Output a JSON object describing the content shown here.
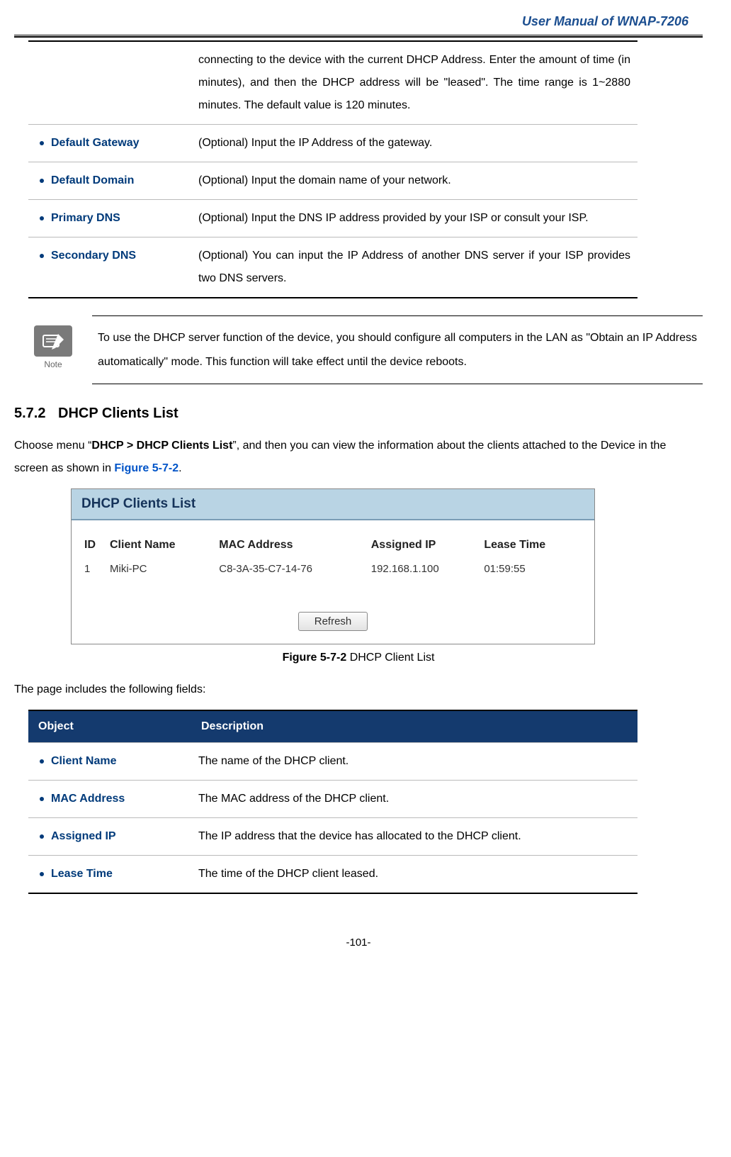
{
  "header": {
    "title": "User Manual of WNAP-7206"
  },
  "table1": {
    "rows": [
      {
        "term": "",
        "desc": "connecting to the device with the current DHCP Address. Enter the amount of time (in minutes), and then the DHCP address will be \"leased\". The time range is 1~2880 minutes. The default value is 120 minutes."
      },
      {
        "term": "Default Gateway",
        "desc": "(Optional) Input the IP Address of the gateway."
      },
      {
        "term": "Default Domain",
        "desc": "(Optional) Input the domain name of your network."
      },
      {
        "term": "Primary DNS",
        "desc": "(Optional) Input the DNS IP address provided by your ISP or consult your ISP."
      },
      {
        "term": "Secondary DNS",
        "desc": "(Optional) You can input the IP Address of another DNS server if your ISP provides two DNS servers."
      }
    ]
  },
  "note": {
    "label": "Note",
    "text": "To use the DHCP server function of the device, you should configure all computers in the LAN as \"Obtain an IP Address automatically\" mode. This function will take effect until the device reboots."
  },
  "section": {
    "number": "5.7.2",
    "title": "DHCP Clients List",
    "para_prefix": "Choose menu “",
    "para_bold": "DHCP > DHCP Clients List",
    "para_mid": "”, and then you can view the information about the clients attached to the Device in the screen as shown in ",
    "para_link": "Figure 5-7-2",
    "para_suffix": "."
  },
  "screenshot": {
    "title": "DHCP Clients List",
    "headers": {
      "id": "ID",
      "name": "Client Name",
      "mac": "MAC Address",
      "ip": "Assigned IP",
      "lease": "Lease Time"
    },
    "row": {
      "id": "1",
      "name": "Miki-PC",
      "mac": "C8-3A-35-C7-14-76",
      "ip": "192.168.1.100",
      "lease": "01:59:55"
    },
    "refresh": "Refresh"
  },
  "figure_caption": {
    "bold": "Figure 5-7-2",
    "rest": " DHCP Client List"
  },
  "fields_intro": "The page includes the following fields:",
  "table2": {
    "head": {
      "object": "Object",
      "description": "Description"
    },
    "rows": [
      {
        "term": "Client Name",
        "desc": "The name of the DHCP client."
      },
      {
        "term": "MAC Address",
        "desc": "The MAC address of the DHCP client."
      },
      {
        "term": "Assigned IP",
        "desc": "The IP address that the device has allocated to the DHCP client."
      },
      {
        "term": "Lease Time",
        "desc": "The time of the DHCP client leased."
      }
    ]
  },
  "page_number": "-101-"
}
